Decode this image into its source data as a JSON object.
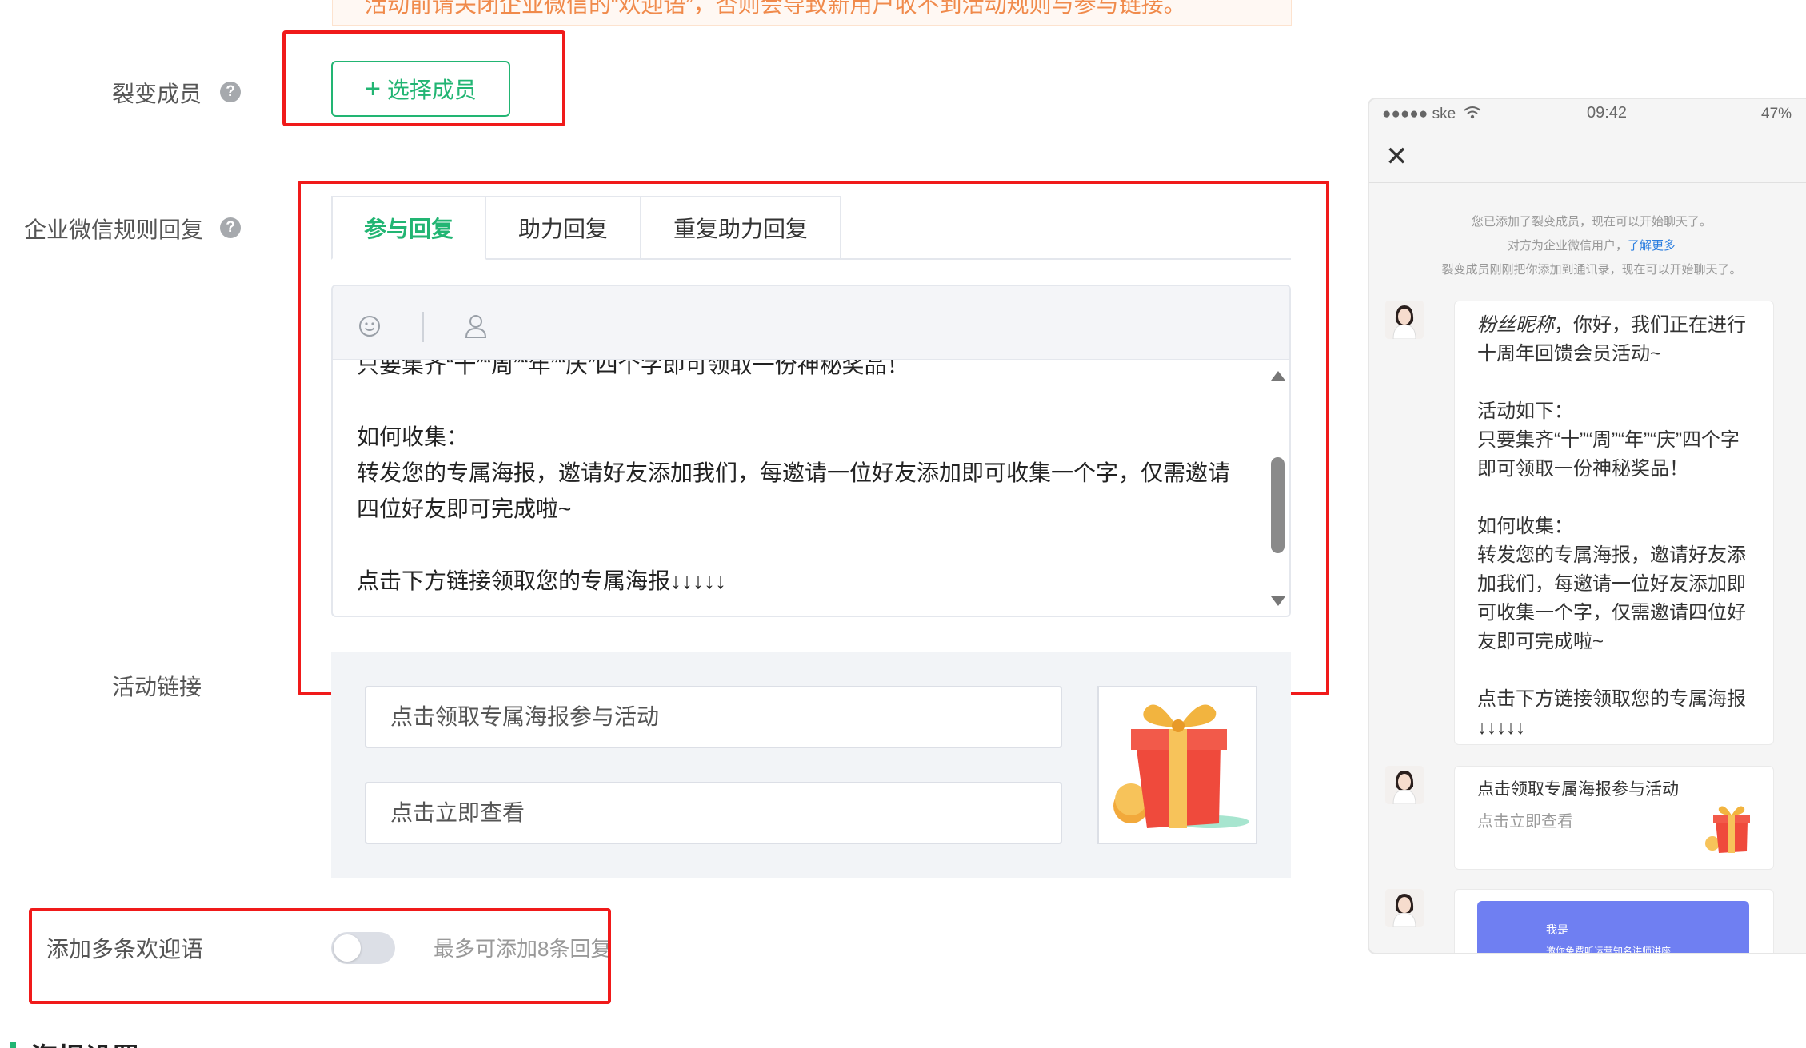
{
  "top_notice": "活动前请关闭企业微信的“欢迎语”，否则会导致新用户收不到活动规则与参与链接。",
  "form": {
    "fission_members_label": "裂变成员",
    "select_members_button": "选择成员",
    "rule_reply_label": "企业微信规则回复",
    "tabs": [
      "参与回复",
      "助力回复",
      "重复助力回复"
    ],
    "reply_text": "只要集齐“十”“周”“年”“庆”四个字即可领取一份神秘奖品！\n\n如何收集：\n转发您的专属海报，邀请好友添加我们，每邀请一位好友添加即可收集一个字，仅需邀请四位好友即可完成啦~\n\n点击下方链接领取您的专属海报↓↓↓↓↓",
    "activity_link_label": "活动链接",
    "link_title_value": "点击领取专属海报参与活动",
    "link_desc_value": "点击立即查看",
    "multi_welcome_label": "添加多条欢迎语",
    "multi_welcome_enabled": false,
    "multi_welcome_hint": "最多可添加8条回复",
    "next_section_heading": "海报设置"
  },
  "phone": {
    "status": {
      "carrier": "●●●●● ske",
      "time": "09:42",
      "battery": "47%"
    },
    "system_lines": [
      "您已添加了裂变成员，现在可以开始聊天了。",
      "对方为企业微信用户，",
      "了解更多",
      "裂变成员刚刚把你添加到通讯录，现在可以开始聊天了。"
    ],
    "bubble_nickname": "粉丝昵称",
    "bubble_text": "，你好，我们正在进行十周年回馈会员活动~\n\n活动如下：\n只要集齐“十”“周”“年”“庆”四个字即可领取一份神秘奖品！\n\n如何收集：\n转发您的专属海报，邀请好友添加我们，每邀请一位好友添加即可收集一个字，仅需邀请四位好友即可完成啦~\n\n点击下方链接领取您的专属海报↓↓↓↓↓",
    "card_title": "点击领取专属海报参与活动",
    "card_desc": "点击立即查看",
    "mini_card_line1": "我是",
    "mini_card_line2": "邀你免费听运营知名讲师讲座"
  },
  "colors": {
    "accent": "#22b573",
    "highlight_box": "#f01a1a",
    "link": "#2a7ee0"
  }
}
